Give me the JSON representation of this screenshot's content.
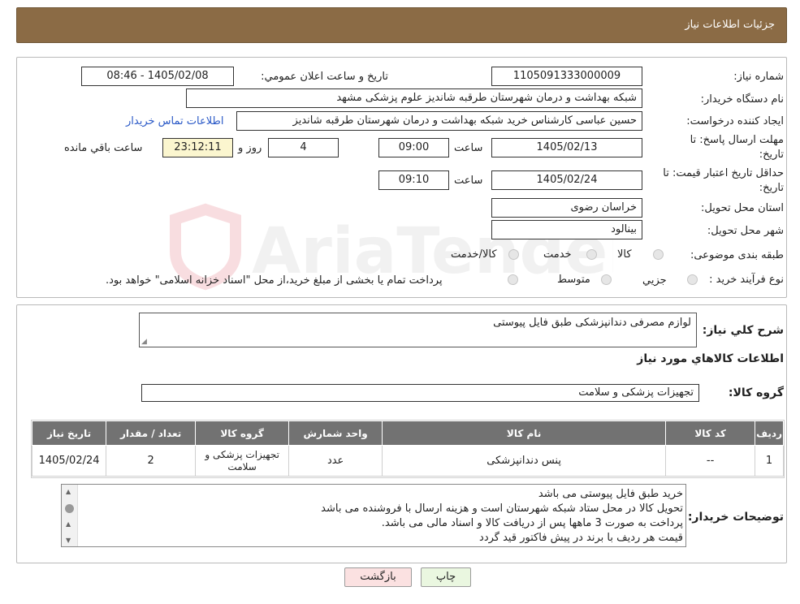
{
  "header": {
    "title": "جزئیات اطلاعات نیاز"
  },
  "form": {
    "need_number_label": "شماره نیاز:",
    "need_number": "1105091333000009",
    "announce_label": "تاريخ و ساعت اعلان عمومي:",
    "announce_value": "1405/02/08 - 08:46",
    "buyer_label": "نام دستگاه خريدار:",
    "buyer_value": "شبکه بهداشت و درمان شهرستان طرقبه شاندیز   علوم پزشکی مشهد",
    "creator_label": "ايجاد کننده درخواست:",
    "creator_value": "حسین عباسی کارشناس خرید شبکه بهداشت و درمان شهرستان طرقبه شاندیز",
    "contact_link": "اطلاعات تماس خريدار",
    "deadline_label_1": "مهلت ارسال پاسخ: تا",
    "deadline_label_2": "تاريخ:",
    "deadline_date": "1405/02/13",
    "time_word": "ساعت",
    "deadline_time": "09:00",
    "days_value": "4",
    "days_word": "روز و",
    "remaining_time": "23:12:11",
    "remaining_word": "ساعت باقي مانده",
    "validity_label_1": "حداقل تاريخ اعتبار قيمت: تا",
    "validity_label_2": "تاريخ:",
    "validity_date": "1405/02/24",
    "validity_time": "09:10",
    "province_label": "استان محل تحويل:",
    "province_value": "خراسان رضوی",
    "city_label": "شهر محل تحويل:",
    "city_value": "بینالود",
    "category_label": "طبقه بندی موضوعی:",
    "category_options": [
      "کالا",
      "خدمت",
      "کالا/خدمت"
    ],
    "process_label": "نوع فرآيند خريد :",
    "process_options": [
      "جزيي",
      "متوسط"
    ],
    "process_note": "پرداخت تمام يا بخشی از مبلغ خريد،از محل \"اسناد خزانه اسلامی\" خواهد بود."
  },
  "summary": {
    "desc_label": "شرح کلي نياز:",
    "desc_value": "لوازم مصرفی دندانپزشکی طبق فایل پیوستی",
    "goods_info_title": "اطلاعات کالاهاي مورد نياز",
    "group_label": "گروه کالا:",
    "group_value": "تجهیزات پزشکی و سلامت"
  },
  "table": {
    "headers": [
      "رديف",
      "کد کالا",
      "نام کالا",
      "واحد شمارش",
      "گروه کالا",
      "تعداد / مقدار",
      "تاريخ نياز"
    ],
    "rows": [
      [
        "1",
        "--",
        "پنس دندانپزشکی",
        "عدد",
        "تجهیزات پزشکی و سلامت",
        "2",
        "1405/02/24"
      ]
    ]
  },
  "notes": {
    "label": "توضيحات خريدار:",
    "lines": [
      "خرید طبق فایل پیوستی می باشد",
      "تحویل کالا در محل ستاد شبکه شهرستان است و هزینه ارسال با فروشنده می باشد",
      "پرداخت به صورت 3 ماهها پس از دریافت کالا و اسناد مالی می باشد.",
      "قیمت هر ردیف با برند در پیش فاکتور قید گردد"
    ]
  },
  "buttons": {
    "print": "چاپ",
    "back": "بازگشت"
  },
  "watermark": {
    "text": "AriaTender.neT"
  },
  "colors": {
    "header_bg": "#8b6b45",
    "table_header_bg": "#727272",
    "link": "#2a59c7"
  }
}
